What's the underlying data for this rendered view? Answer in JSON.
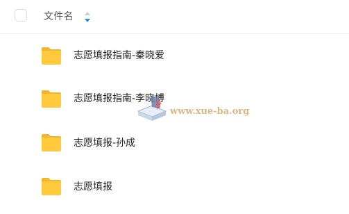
{
  "header": {
    "column_label": "文件名",
    "sort_icon": "sort-icon",
    "select_all_icon": "checkbox-icon"
  },
  "files": [
    {
      "name": "志愿填报指南-秦晓爱",
      "type": "folder",
      "icon": "folder-icon"
    },
    {
      "name": "志愿填报指南-李晓博",
      "type": "folder",
      "icon": "folder-icon"
    },
    {
      "name": "志愿填报-孙成",
      "type": "folder",
      "icon": "folder-icon"
    },
    {
      "name": "志愿填报",
      "type": "folder",
      "icon": "folder-icon"
    }
  ],
  "watermark": {
    "text": "www.xue-ba.org",
    "icon": "book-icon"
  },
  "colors": {
    "folder": "#ffc93c",
    "folder_tab": "#f2b62e",
    "sort_up": "#c8ccd4",
    "sort_down": "#2d8cf0",
    "watermark": "#c9a25a"
  }
}
